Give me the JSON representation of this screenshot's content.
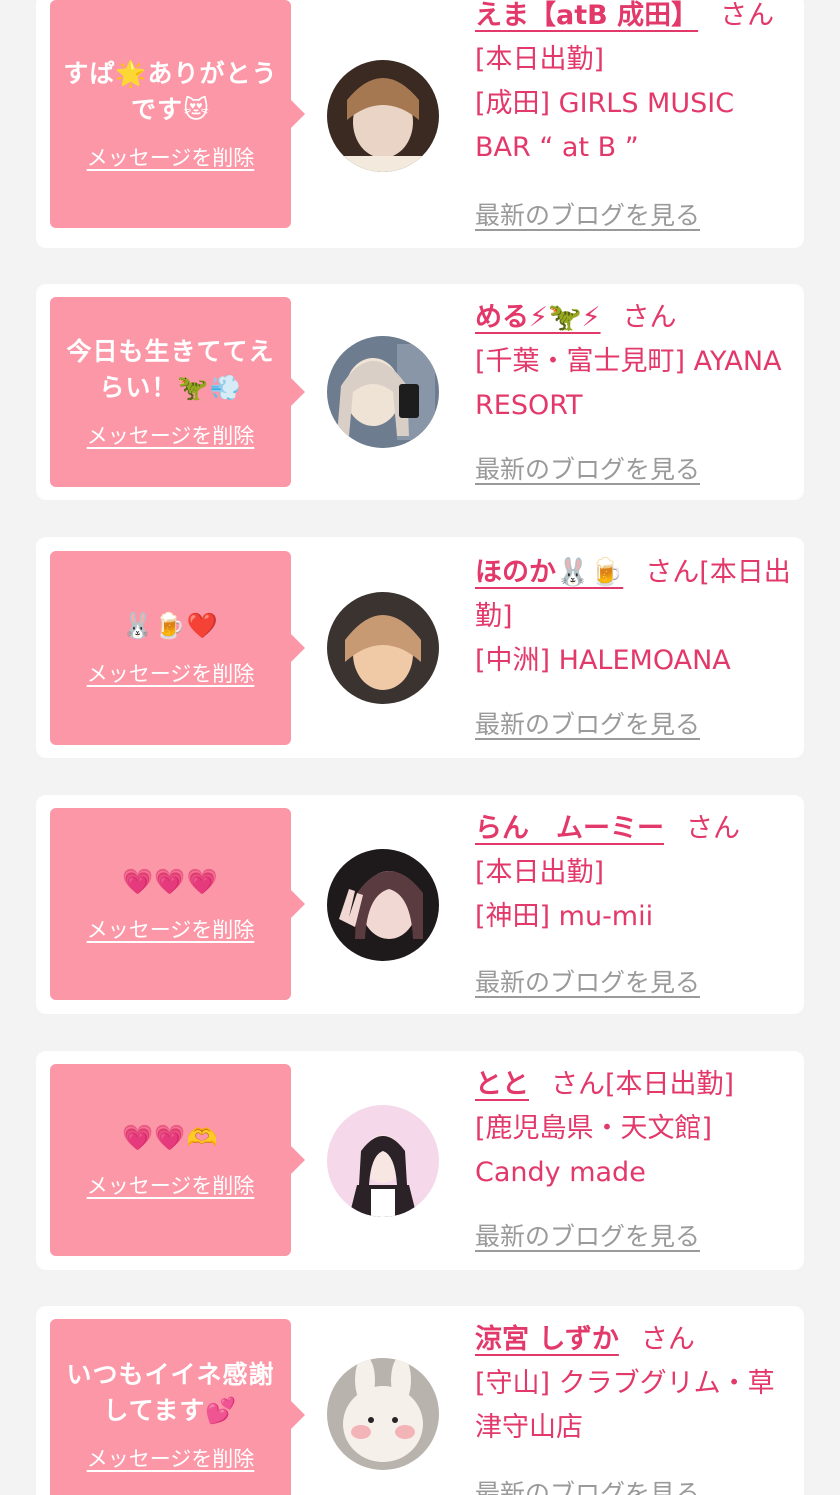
{
  "colors": {
    "background": "#f3f3f3",
    "card": "#ffffff",
    "bubble": "#fc97a7",
    "accent_text": "#e2386a",
    "link_gray": "#9a9a9a"
  },
  "delete_label": "メッセージを削除",
  "blog_label": "最新のブログを見る",
  "honorific": "さん",
  "cards": [
    {
      "message": "すぱ🌟ありがとうです😻",
      "name": "えま【atB 成田】",
      "line1": "[本日出勤]",
      "line2": "[成田] GIRLS MUSIC BAR “ at B ”",
      "avatar_colors": [
        "#3a2a22",
        "#e9d4c6",
        "#a67852"
      ]
    },
    {
      "message": "今日も生きててえらい！🦖💨",
      "name": "める⚡🦖⚡",
      "line1": "[千葉・富士見町] AYANA RESORT",
      "line2": "",
      "avatar_colors": [
        "#6d7c8f",
        "#efe3d6",
        "#d9cfc7"
      ]
    },
    {
      "message": "🐰🍺❤️",
      "name": "ほのか🐰🍺",
      "line1": "[本日出勤]",
      "line2": "[中洲] HALEMOANA",
      "avatar_colors": [
        "#3b3330",
        "#f0c9a6",
        "#c89a74"
      ]
    },
    {
      "message": "💗💗💗",
      "name": "らん　ムーミー",
      "line1": "[本日出勤]",
      "line2": "[神田] mu-mii",
      "avatar_colors": [
        "#1e1a1c",
        "#f2d8d3",
        "#5a3c40"
      ]
    },
    {
      "message": "💗💗🫶",
      "name": "とと",
      "line1": "[本日出勤]",
      "line2": "[鹿児島県・天文館] Candy made",
      "avatar_colors": [
        "#f5d9ea",
        "#f7e6e2",
        "#2a2226"
      ]
    },
    {
      "message": "いつもイイネ感謝してます💕",
      "name": "涼宮 しずか",
      "line1": "[守山] クラブグリム・草津守山店",
      "line2": "",
      "avatar_colors": [
        "#b9b3ad",
        "#f6f0ea",
        "#f3b4b7"
      ]
    }
  ]
}
